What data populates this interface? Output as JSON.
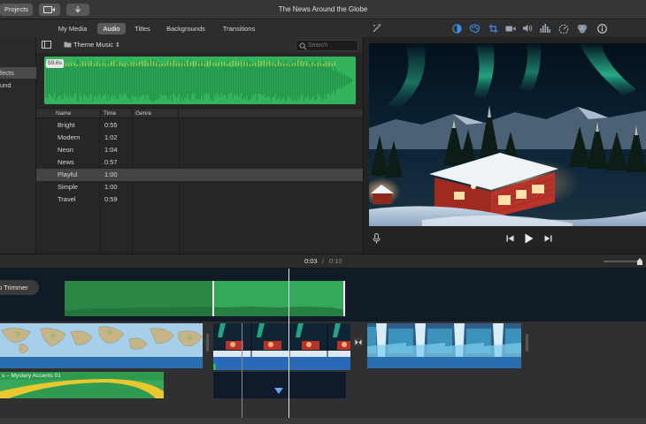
{
  "titlebar": {
    "projects_label": "Projects",
    "title": "The News Around the Globe"
  },
  "tabs": [
    {
      "label": "My Media",
      "active": false
    },
    {
      "label": "Audio",
      "active": true
    },
    {
      "label": "Titles",
      "active": false
    },
    {
      "label": "Backgrounds",
      "active": false
    },
    {
      "label": "Transitions",
      "active": false
    }
  ],
  "sidebar": {
    "items": [
      {
        "label": "fects",
        "selected": true
      },
      {
        "label": "und",
        "selected": false
      }
    ]
  },
  "browser": {
    "source_label": "Theme Music",
    "search_placeholder": "Search",
    "preview_duration": "59.6s",
    "columns": [
      "Name",
      "Time",
      "Genre"
    ],
    "tracks": [
      {
        "name": "Bright",
        "time": "0:55",
        "selected": false
      },
      {
        "name": "Modern",
        "time": "1:02",
        "selected": false
      },
      {
        "name": "Neon",
        "time": "1:04",
        "selected": false
      },
      {
        "name": "News",
        "time": "0:57",
        "selected": false
      },
      {
        "name": "Playful",
        "time": "1:00",
        "selected": true
      },
      {
        "name": "Simple",
        "time": "1:00",
        "selected": false
      },
      {
        "name": "Travel",
        "time": "0:59",
        "selected": false
      }
    ]
  },
  "viewer": {
    "current_time": "0:03",
    "separator": "/",
    "total_time": "0:10"
  },
  "timeline": {
    "trimmer_label": "p Trimmer",
    "audio_clip_label": "s – Mystery Accents 01"
  },
  "icons": {
    "magic_wand": "magic-wand-icon",
    "color_balance": "color-balance-icon",
    "color_correction": "color-correction-icon",
    "crop": "crop-icon",
    "camera": "camera-icon",
    "volume": "volume-icon",
    "equalizer": "equalizer-icon",
    "speed": "speed-icon",
    "filter": "filter-icon",
    "info": "info-icon"
  },
  "colors": {
    "accent": "#3b8fe8",
    "audio_green": "#33b35c",
    "clip_blue": "#2a68b8",
    "music_green": "#2d9a4e",
    "mystery_yellow": "#e8c82e"
  }
}
